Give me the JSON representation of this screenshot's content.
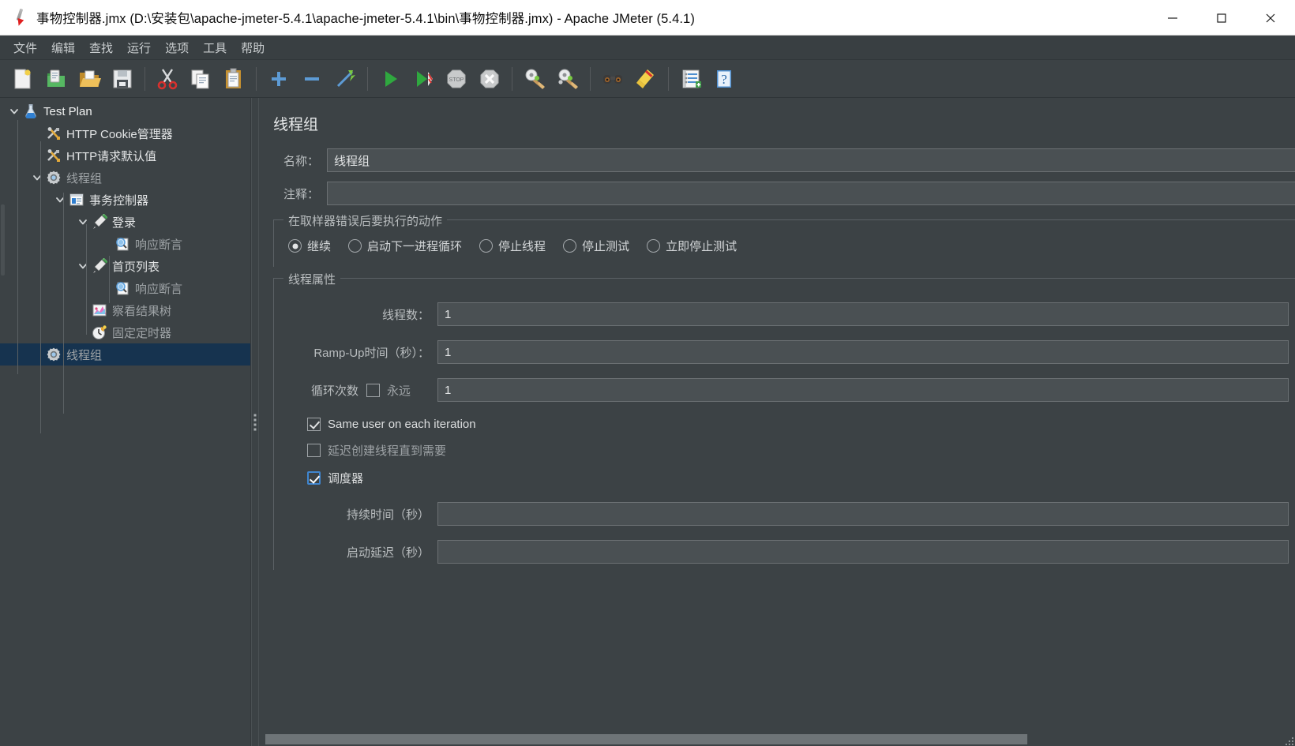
{
  "window": {
    "title": "事物控制器.jmx (D:\\安装包\\apache-jmeter-5.4.1\\apache-jmeter-5.4.1\\bin\\事物控制器.jmx) - Apache JMeter (5.4.1)",
    "app_icon": "jmeter-feather-icon",
    "minimize_label": "—",
    "maximize_label": "□",
    "close_label": "✕"
  },
  "menubar": {
    "items": [
      {
        "label": "文件",
        "name": "menu-file"
      },
      {
        "label": "编辑",
        "name": "menu-edit"
      },
      {
        "label": "查找",
        "name": "menu-search"
      },
      {
        "label": "运行",
        "name": "menu-run"
      },
      {
        "label": "选项",
        "name": "menu-options"
      },
      {
        "label": "工具",
        "name": "menu-tools"
      },
      {
        "label": "帮助",
        "name": "menu-help"
      }
    ]
  },
  "toolbar": {
    "groups": [
      [
        "new-file-icon",
        "templates-icon",
        "open-folder-icon",
        "save-icon"
      ],
      [
        "cut-icon",
        "copy-icon",
        "paste-icon"
      ],
      [
        "expand-all-icon",
        "collapse-all-icon",
        "toggle-icon"
      ],
      [
        "start-icon",
        "start-no-pauses-icon",
        "stop-icon",
        "shutdown-icon"
      ],
      [
        "clear-icon",
        "clear-all-icon"
      ],
      [
        "search-icon",
        "search-reset-icon"
      ],
      [
        "function-helper-icon",
        "help-icon"
      ]
    ]
  },
  "tree": {
    "nodes": [
      {
        "label": "Test Plan",
        "icon": "test-plan-icon",
        "depth": 0,
        "twisty": "open",
        "selected": false,
        "dim": false,
        "name": "tree-node-test-plan"
      },
      {
        "label": "HTTP Cookie管理器",
        "icon": "config-element-icon",
        "depth": 1,
        "twisty": "none",
        "selected": false,
        "dim": false,
        "name": "tree-node-http-cookie-manager"
      },
      {
        "label": "HTTP请求默认值",
        "icon": "config-element-icon",
        "depth": 1,
        "twisty": "none",
        "selected": false,
        "dim": false,
        "name": "tree-node-http-request-defaults"
      },
      {
        "label": "线程组",
        "icon": "thread-group-icon",
        "depth": 1,
        "twisty": "open",
        "selected": false,
        "dim": true,
        "name": "tree-node-thread-group-1"
      },
      {
        "label": "事务控制器",
        "icon": "transaction-controller-icon",
        "depth": 2,
        "twisty": "open",
        "selected": false,
        "dim": false,
        "name": "tree-node-transaction-controller"
      },
      {
        "label": "登录",
        "icon": "http-sampler-icon",
        "depth": 3,
        "twisty": "open",
        "selected": false,
        "dim": false,
        "name": "tree-node-login"
      },
      {
        "label": "响应断言",
        "icon": "response-assertion-icon",
        "depth": 4,
        "twisty": "none",
        "selected": false,
        "dim": true,
        "name": "tree-node-response-assertion-1"
      },
      {
        "label": "首页列表",
        "icon": "http-sampler-icon",
        "depth": 3,
        "twisty": "open",
        "selected": false,
        "dim": false,
        "name": "tree-node-home-list"
      },
      {
        "label": "响应断言",
        "icon": "response-assertion-icon",
        "depth": 4,
        "twisty": "none",
        "selected": false,
        "dim": true,
        "name": "tree-node-response-assertion-2"
      },
      {
        "label": "察看结果树",
        "icon": "view-results-tree-icon",
        "depth": 3,
        "twisty": "none",
        "selected": false,
        "dim": true,
        "name": "tree-node-view-results-tree"
      },
      {
        "label": "固定定时器",
        "icon": "constant-timer-icon",
        "depth": 3,
        "twisty": "none",
        "selected": false,
        "dim": true,
        "name": "tree-node-constant-timer"
      },
      {
        "label": "线程组",
        "icon": "thread-group-icon",
        "depth": 1,
        "twisty": "none",
        "selected": true,
        "dim": true,
        "name": "tree-node-thread-group-2"
      }
    ]
  },
  "panel": {
    "title": "线程组",
    "name_label": "名称：",
    "name_value": "线程组",
    "comment_label": "注释：",
    "comment_value": "",
    "error_action": {
      "group_title": "在取样器错误后要执行的动作",
      "options": [
        {
          "label": "继续",
          "selected": true,
          "name": "radio-continue"
        },
        {
          "label": "启动下一进程循环",
          "selected": false,
          "name": "radio-start-next-loop"
        },
        {
          "label": "停止线程",
          "selected": false,
          "name": "radio-stop-thread"
        },
        {
          "label": "停止测试",
          "selected": false,
          "name": "radio-stop-test"
        },
        {
          "label": "立即停止测试",
          "selected": false,
          "name": "radio-stop-test-now"
        }
      ]
    },
    "thread_properties": {
      "group_title": "线程属性",
      "num_threads_label": "线程数：",
      "num_threads_value": "1",
      "ramp_up_label": "Ramp-Up时间（秒）：",
      "ramp_up_value": "1",
      "loop_count_label": "循环次数",
      "forever_label": "永远",
      "forever_checked": false,
      "loop_count_value": "1",
      "same_user_label": "Same user on each iteration",
      "same_user_checked": true,
      "delayed_start_label": "延迟创建线程直到需要",
      "delayed_start_checked": false,
      "scheduler_label": "调度器",
      "scheduler_checked": true,
      "duration_label": "持续时间（秒）",
      "duration_value": "",
      "startup_delay_label": "启动延迟（秒）",
      "startup_delay_value": ""
    }
  },
  "colors": {
    "window_bg": "#3c4245",
    "titlebar_bg": "#ffffff",
    "menubar_bg": "#393f42",
    "field_bg": "#4a5053",
    "field_border": "#6b7073",
    "selection_bg": "#16334f",
    "accent": "#3f86d0",
    "text_primary": "#e4e6e7",
    "text_dim": "#9ea3a6"
  }
}
